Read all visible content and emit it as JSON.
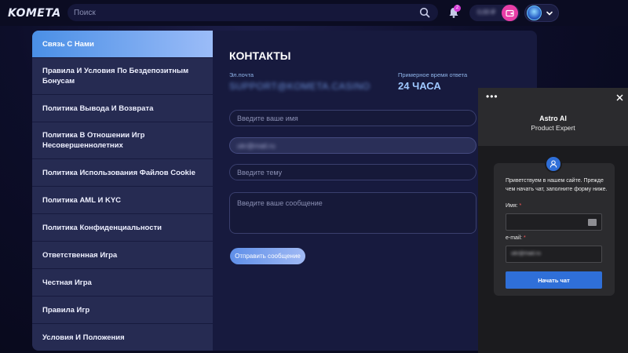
{
  "header": {
    "logo": "KOMETA",
    "search_placeholder": "Поиск",
    "notification_count": "2",
    "balance": "0,00 ₽"
  },
  "sidebar": {
    "items": [
      {
        "label": "Связь С Нами",
        "active": true
      },
      {
        "label": "Правила И Условия По Бездепозитным Бонусам",
        "active": false
      },
      {
        "label": "Политика Вывода И Возврата",
        "active": false
      },
      {
        "label": "Политика В Отношении Игр Несовершеннолетних",
        "active": false
      },
      {
        "label": "Политика Использования Файлов Cookie",
        "active": false
      },
      {
        "label": "Политика AML И KYC",
        "active": false
      },
      {
        "label": "Политика Конфиденциальности",
        "active": false
      },
      {
        "label": "Ответственная Игра",
        "active": false
      },
      {
        "label": "Честная Игра",
        "active": false
      },
      {
        "label": "Правила Игр",
        "active": false
      },
      {
        "label": "Условия И Положения",
        "active": false
      }
    ]
  },
  "contacts": {
    "title": "КОНТАКТЫ",
    "email_label": "Эл.почта",
    "email_value": "SUPPORT@KOMETA.CASINO",
    "response_label": "Примерное время ответа",
    "response_value": "24 ЧАСА",
    "name_placeholder": "Введите ваше имя",
    "email_field_value": "ukr@mail.ru",
    "subject_placeholder": "Введите тему",
    "message_placeholder": "Введите ваше сообщение",
    "send_label": "Отправить сообщение"
  },
  "chat": {
    "menu_dots": "•••",
    "agent_name": "Astro AI",
    "agent_role": "Product Expert",
    "greeting": "Приветствуем в нашем сайте. Прежде чем начать чат, заполните форму ниже.",
    "name_label": "Имя:",
    "email_label": "e-mail:",
    "required_mark": "*",
    "email_value": "ukr@mail.ru",
    "start_label": "Начать чат"
  },
  "colors": {
    "accent": "#4a8fe6",
    "chat_button": "#2f6fd8",
    "wallet": "#e83ea7"
  }
}
